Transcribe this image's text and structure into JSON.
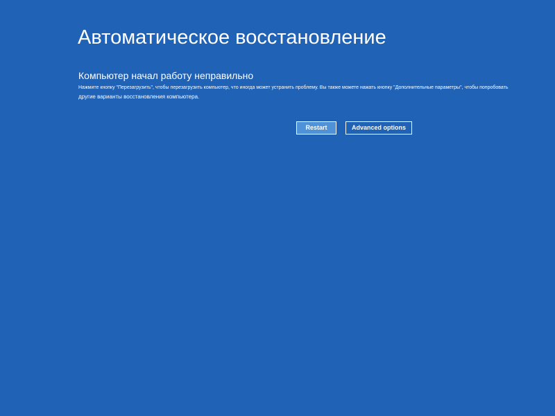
{
  "colors": {
    "background": "#2062b5",
    "text": "#ffffff",
    "primary_button": "#4f92d8",
    "secondary_button": "#2062b5",
    "button_border": "#ffffff"
  },
  "screen": {
    "title": "Автоматическое восстановление",
    "subtitle": "Компьютер начал работу неправильно",
    "description_line1": "Нажмите кнопку \"Перезагрузить\", чтобы перезагрузить компьютер, что иногда может устранить проблему. Вы также можете нажать кнопку \"Дополнительные параметры\", чтобы попробовать",
    "description_line2": "другие варианты восстановления компьютера."
  },
  "buttons": {
    "restart_label": "Restart",
    "advanced_label": "Advanced options"
  }
}
